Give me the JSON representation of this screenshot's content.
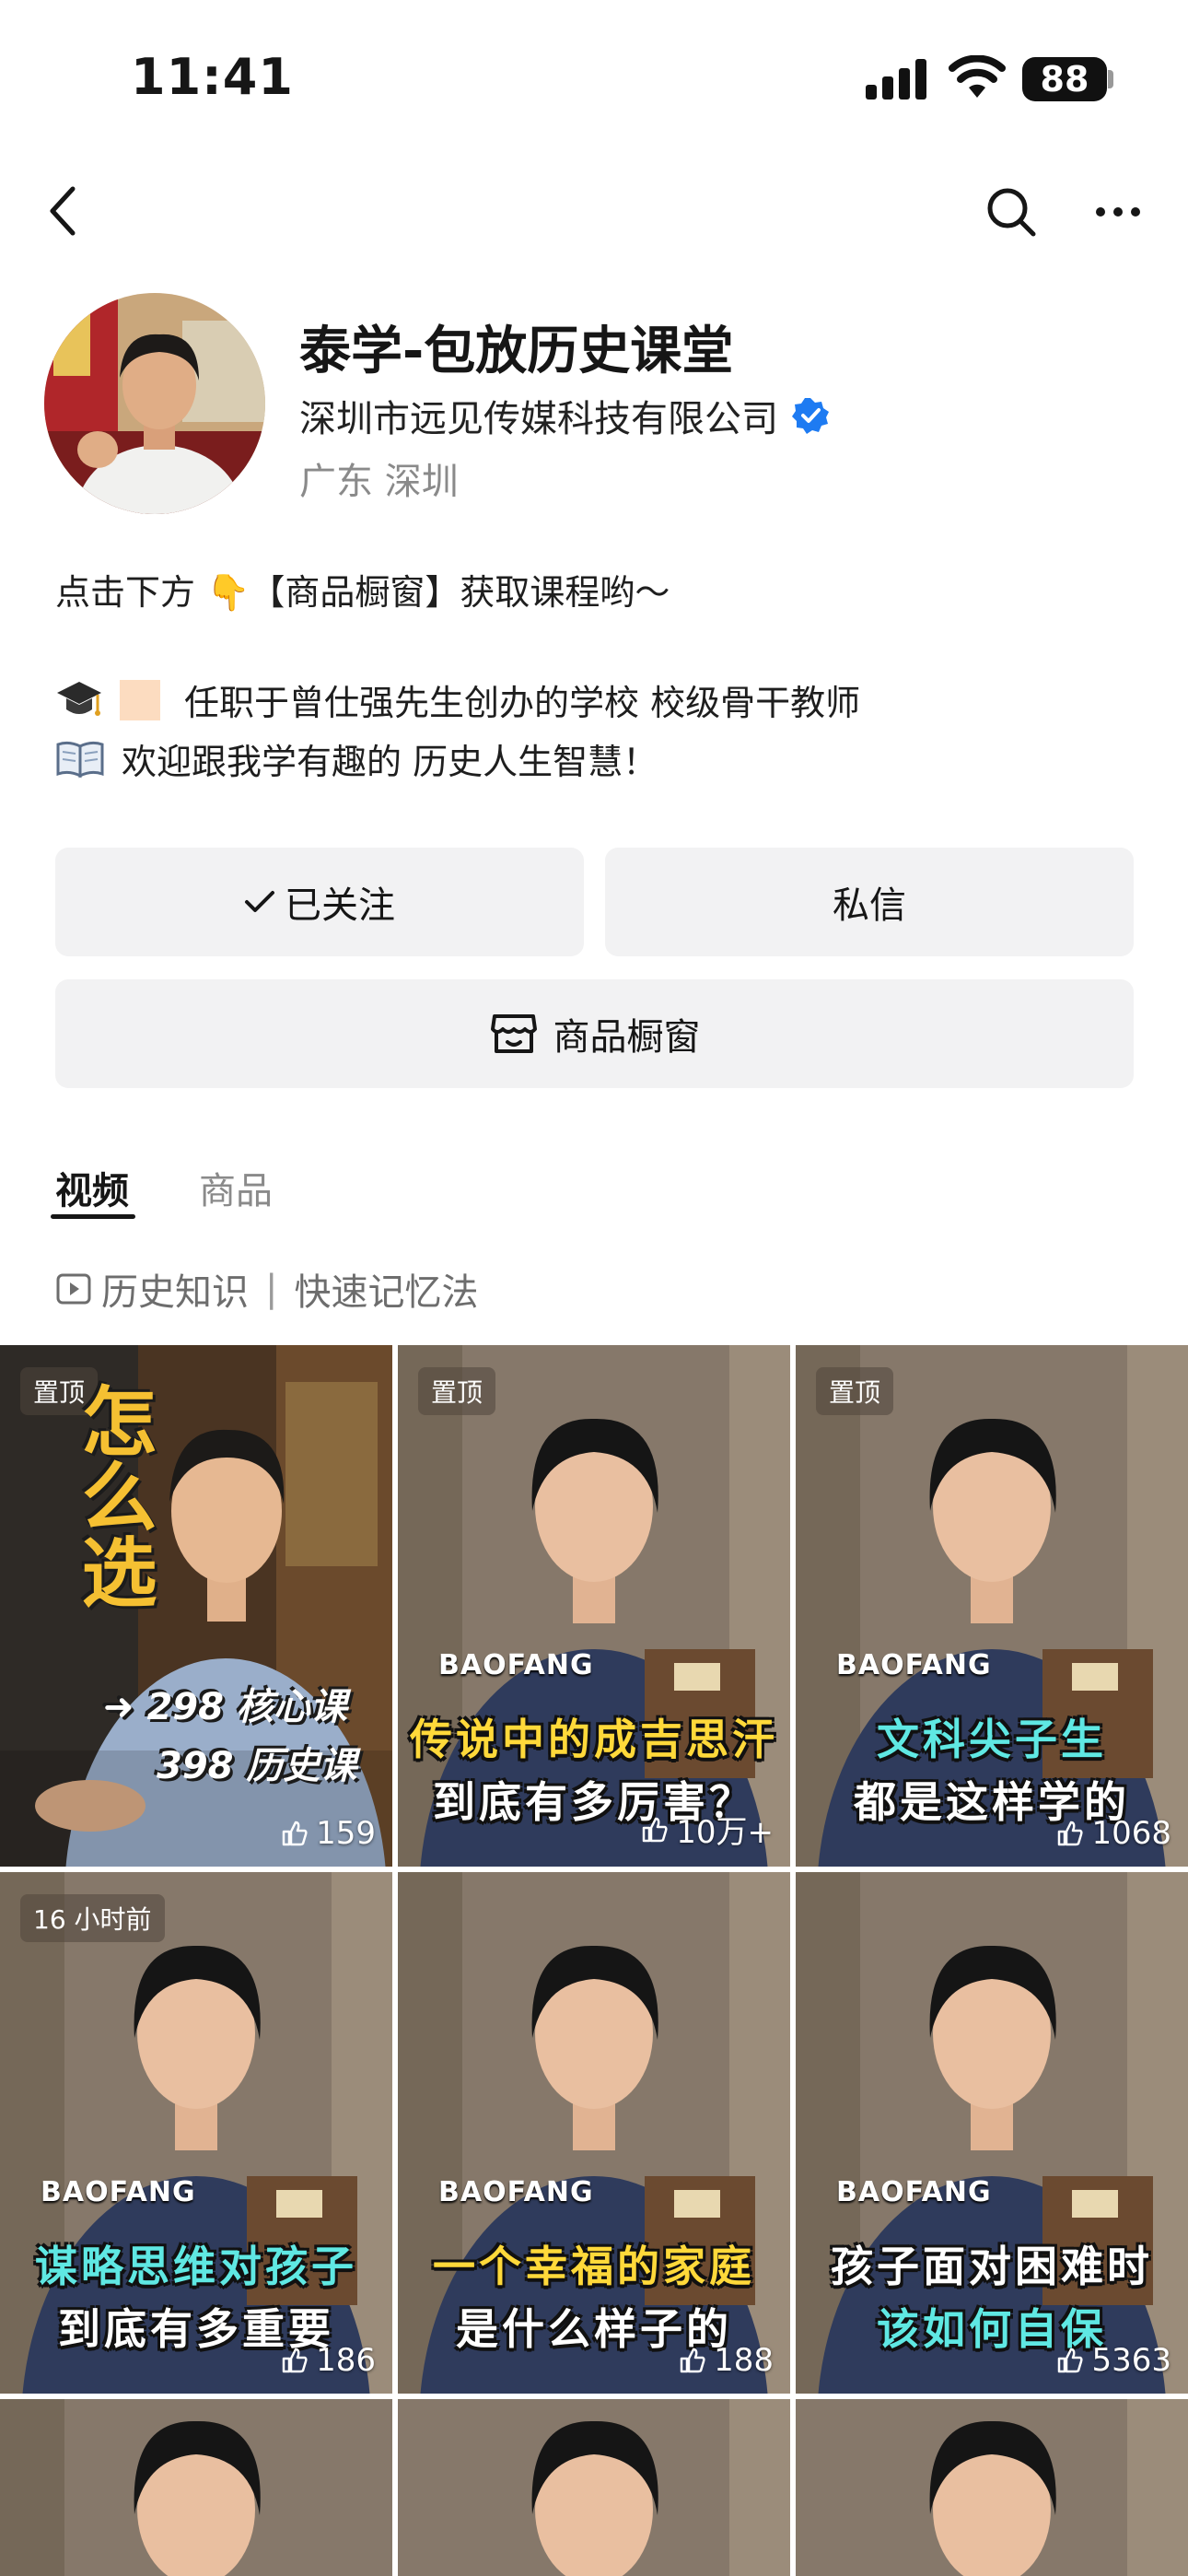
{
  "status_bar": {
    "time": "11:41",
    "battery": "88"
  },
  "profile": {
    "name": "泰学-包放历史课堂",
    "company": "深圳市远见传媒科技有限公司",
    "location": "广东 深圳"
  },
  "bio": {
    "line1": "点击下方 👇【商品橱窗】获取课程哟～",
    "line2": "任职于曾仕强先生创办的学校 校级骨干教师",
    "line3": "欢迎跟我学有趣的 历史人生智慧！"
  },
  "buttons": {
    "followed": "已关注",
    "message": "私信",
    "shop": "商品橱窗"
  },
  "tabs": {
    "videos": "视频",
    "goods": "商品"
  },
  "collection": {
    "label1": "历史知识",
    "label2": "快速记忆法"
  },
  "videos": [
    {
      "badge": "置顶",
      "likes": "159",
      "side_text": "怎么选",
      "line1": "298 核心课",
      "line2": "398 历史课"
    },
    {
      "badge": "置顶",
      "likes": "10万+",
      "brand": "BAOFANG",
      "caption1": "传说中的成吉思汗",
      "caption2": "到底有多厉害？"
    },
    {
      "badge": "置顶",
      "likes": "1068",
      "brand": "BAOFANG",
      "caption1": "文科尖子生",
      "caption2": "都是这样学的"
    },
    {
      "badge": "16 小时前",
      "likes": "186",
      "brand": "BAOFANG",
      "caption1": "谋略思维对孩子",
      "caption2": "到底有多重要"
    },
    {
      "badge": "",
      "likes": "188",
      "brand": "BAOFANG",
      "caption1": "一个幸福的家庭",
      "caption2": "是什么样子的"
    },
    {
      "badge": "",
      "likes": "5363",
      "brand": "BAOFANG",
      "caption1": "孩子面对困难时",
      "caption2": "该如何自保"
    }
  ],
  "colors": {
    "accent_blue": "#1e7bf2",
    "button_bg": "#f2f2f3",
    "caption_yellow": "#ffd93a",
    "caption_cyan": "#5fe8e3"
  }
}
